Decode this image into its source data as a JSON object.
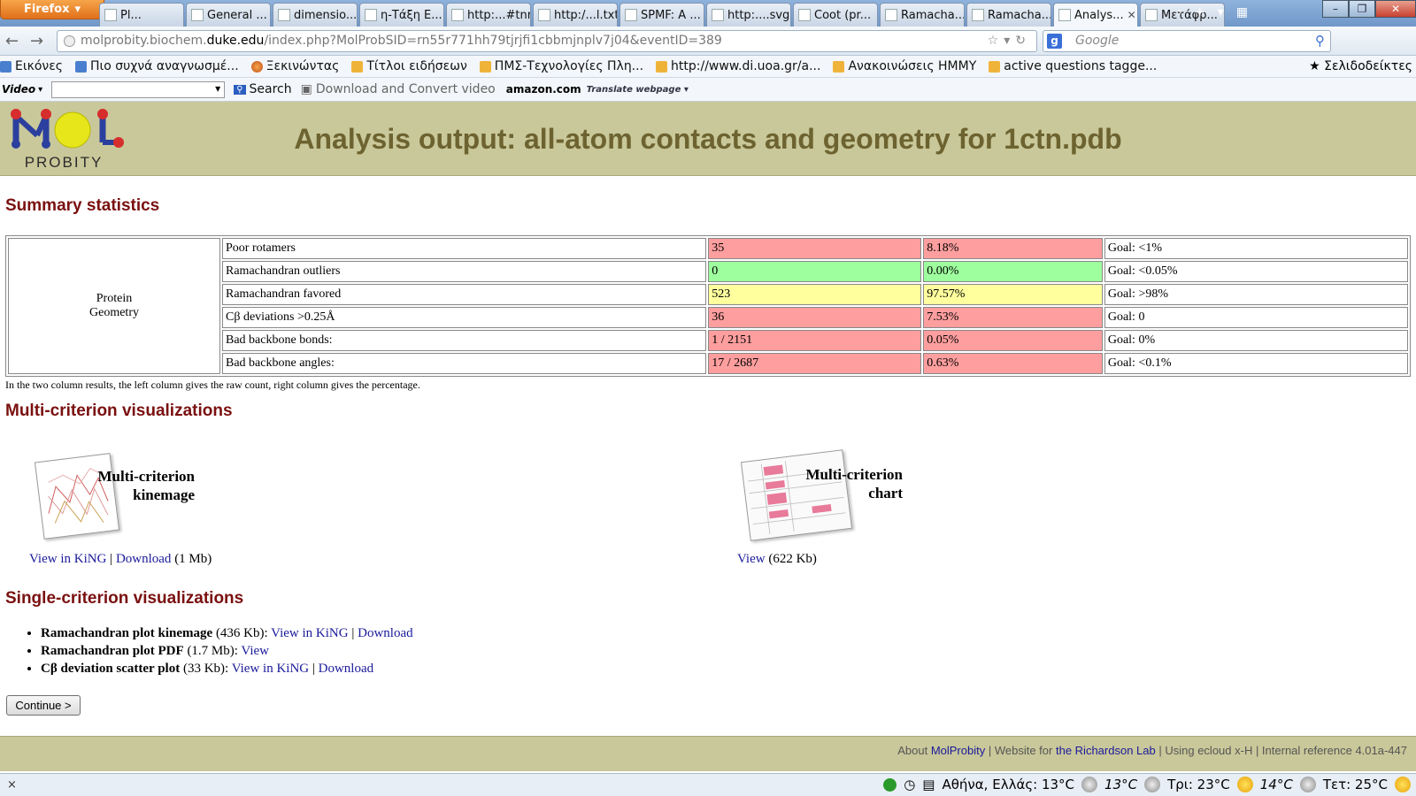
{
  "browser": {
    "app_button": "Firefox",
    "tabs": [
      {
        "label": "Pl..."
      },
      {
        "label": "General ..."
      },
      {
        "label": "dimensio..."
      },
      {
        "label": "η-Τάξη Ε..."
      },
      {
        "label": "http:...#tnr"
      },
      {
        "label": "http:/...l.txt"
      },
      {
        "label": "SPMF: A ..."
      },
      {
        "label": "http:....svg"
      },
      {
        "label": "Coot (pr..."
      },
      {
        "label": "Ramacha..."
      },
      {
        "label": "Ramacha..."
      },
      {
        "label": "Analys..."
      },
      {
        "label": "Μετάφρ..."
      }
    ],
    "url_prefix": "molprobity.biochem.",
    "url_domain": "duke.edu",
    "url_rest": "/index.php?MolProbSID=rn55r771hh79tjrjfi1cbbmjnplv7j04&eventID=389",
    "search_placeholder": "Google",
    "bookmarks": [
      {
        "label": "Εικόνες",
        "icon": "blue"
      },
      {
        "label": "Πιο συχνά αναγνωσμέ...",
        "icon": "blue"
      },
      {
        "label": "Ξεκινώντας",
        "icon": "fox"
      },
      {
        "label": "Τίτλοι ειδήσεων",
        "icon": "rss"
      },
      {
        "label": "ΠΜΣ-Τεχνολογίες Πλη...",
        "icon": "rss"
      },
      {
        "label": "http://www.di.uoa.gr/a...",
        "icon": "rss"
      },
      {
        "label": "Ανακοινώσεις HMMY",
        "icon": "rss"
      },
      {
        "label": "active questions tagge...",
        "icon": "rss"
      }
    ],
    "bookmarks_menu": "Σελιδοδείκτες",
    "video_label": "Video",
    "search_button": "Search",
    "download_convert": "Download and Convert video",
    "amazon": "amazon.com",
    "translate": "Translate webpage"
  },
  "page": {
    "logo_text": "PROBITY",
    "title": "Analysis output: all-atom contacts and geometry for 1ctn.pdb",
    "summary_heading": "Summary statistics",
    "category_line1": "Protein",
    "category_line2": "Geometry",
    "rows": [
      {
        "label": "Poor rotamers",
        "count": "35",
        "percent": "8.18%",
        "goal": "Goal: <1%",
        "status": "red"
      },
      {
        "label": "Ramachandran outliers",
        "count": "0",
        "percent": "0.00%",
        "goal": "Goal: <0.05%",
        "status": "green"
      },
      {
        "label": "Ramachandran favored",
        "count": "523",
        "percent": "97.57%",
        "goal": "Goal: >98%",
        "status": "yellow"
      },
      {
        "label": "Cβ deviations >0.25Å",
        "count": "36",
        "percent": "7.53%",
        "goal": "Goal: 0",
        "status": "red"
      },
      {
        "label": "Bad backbone bonds:",
        "count": "1 / 2151",
        "percent": "0.05%",
        "goal": "Goal: 0%",
        "status": "red"
      },
      {
        "label": "Bad backbone angles:",
        "count": "17 / 2687",
        "percent": "0.63%",
        "goal": "Goal: <0.1%",
        "status": "red"
      }
    ],
    "note": "In the two column results, the left column gives the raw count, right column gives the percentage.",
    "multi_heading": "Multi-criterion visualizations",
    "kinemage": {
      "caption1": "Multi-criterion",
      "caption2": "kinemage",
      "view": "View in KiNG",
      "sep": "|",
      "download": "Download",
      "size": "(1 Mb)"
    },
    "chart": {
      "caption1": "Multi-criterion",
      "caption2": "chart",
      "view": "View",
      "size": "(622 Kb)"
    },
    "single_heading": "Single-criterion visualizations",
    "single_items": [
      {
        "name": "Ramachandran plot kinemage",
        "size": "(436 Kb):",
        "link1": "View in KiNG",
        "sep": "|",
        "link2": "Download"
      },
      {
        "name": "Ramachandran plot PDF",
        "size": "(1.7 Mb):",
        "link1": "View",
        "sep": "",
        "link2": ""
      },
      {
        "name": "Cβ deviation scatter plot",
        "size": "(33 Kb):",
        "link1": "View in KiNG",
        "sep": "|",
        "link2": "Download"
      }
    ],
    "continue_button": "Continue >",
    "footer": {
      "about": "About",
      "molprobity": "MolProbity",
      "website_for": "| Website for",
      "lab": "the Richardson Lab",
      "rest": "| Using ecloud x-H | Internal reference 4.01a-447"
    }
  },
  "statusbar": {
    "close": "×",
    "location": "Αθήνα, Ελλάς: 13°C",
    "t1": "13°C",
    "t2": "Τρι: 23°C",
    "t3": "14°C",
    "t4": "Τετ: 25°C"
  },
  "colors": {
    "header_bg": "#c9c89a",
    "title": "#6d6330",
    "section_heading": "#7a1010",
    "red_cell": "#ff9e9e",
    "green_cell": "#9eff9e",
    "yellow_cell": "#ffff9e"
  }
}
